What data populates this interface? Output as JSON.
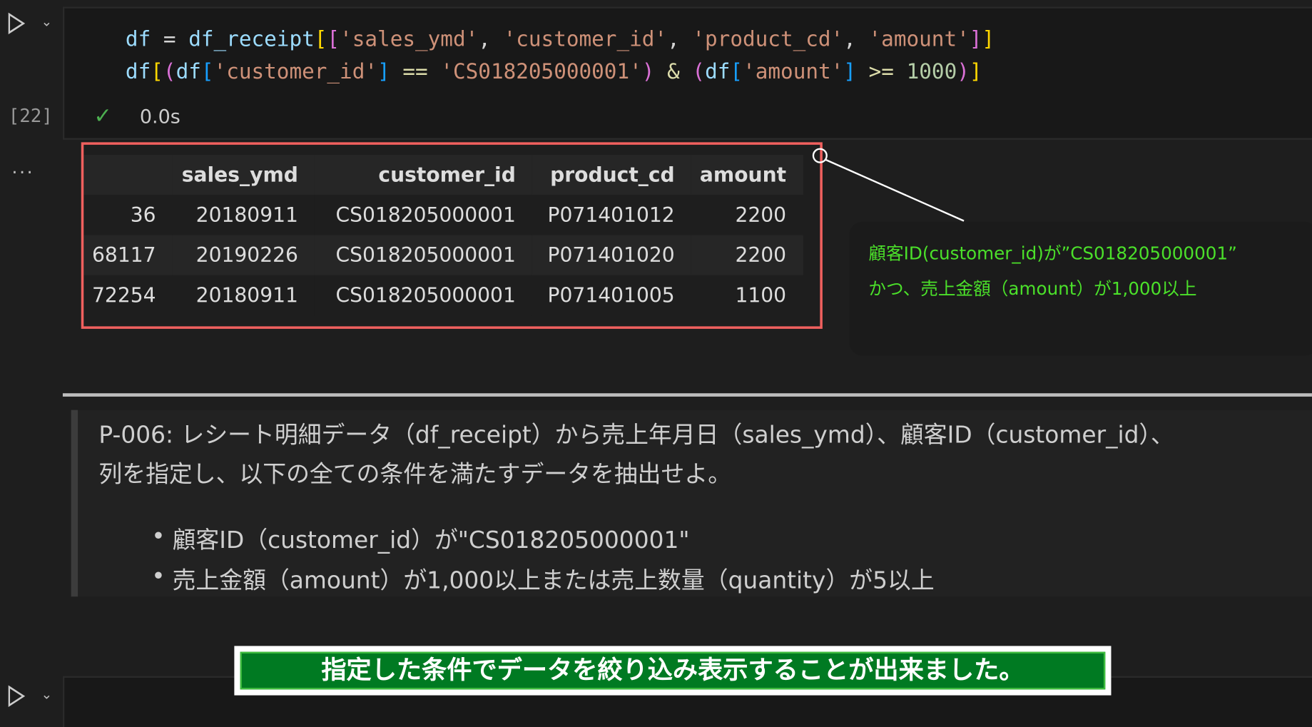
{
  "code_cell": {
    "execution_count": "[22]",
    "status_icon": "check-icon",
    "duration": "0.0s",
    "lines": [
      "df = df_receipt[['sales_ymd', 'customer_id', 'product_cd', 'amount']]",
      "df[(df['customer_id'] == 'CS018205000001') & (df['amount'] >= 1000)]"
    ]
  },
  "output": {
    "more_label": "...",
    "columns": [
      "",
      "sales_ymd",
      "customer_id",
      "product_cd",
      "amount"
    ],
    "rows": [
      [
        "36",
        "20180911",
        "CS018205000001",
        "P071401012",
        "2200"
      ],
      [
        "68117",
        "20190226",
        "CS018205000001",
        "P071401020",
        "2200"
      ],
      [
        "72254",
        "20180911",
        "CS018205000001",
        "P071401005",
        "1100"
      ]
    ],
    "highlight_color": "#f0605e"
  },
  "annotation": {
    "line1": "顧客ID(customer_id)が”CS018205000001”",
    "line2": "かつ、売上金額（amount）が1,000以上",
    "color": "#4be02a"
  },
  "markdown": {
    "line1": "P-006: レシート明細データ（df_receipt）から売上年月日（sales_ymd）、顧客ID（customer_id）、",
    "line2": "列を指定し、以下の全ての条件を満たすデータを抽出せよ。",
    "bullets": [
      "顧客ID（customer_id）が\"CS018205000001\"",
      "売上金額（amount）が1,000以上または売上数量（quantity）が5以上"
    ]
  },
  "banner": {
    "text": "指定した条件でデータを絞り込み表示することが出来ました。",
    "color": "#007a22"
  }
}
